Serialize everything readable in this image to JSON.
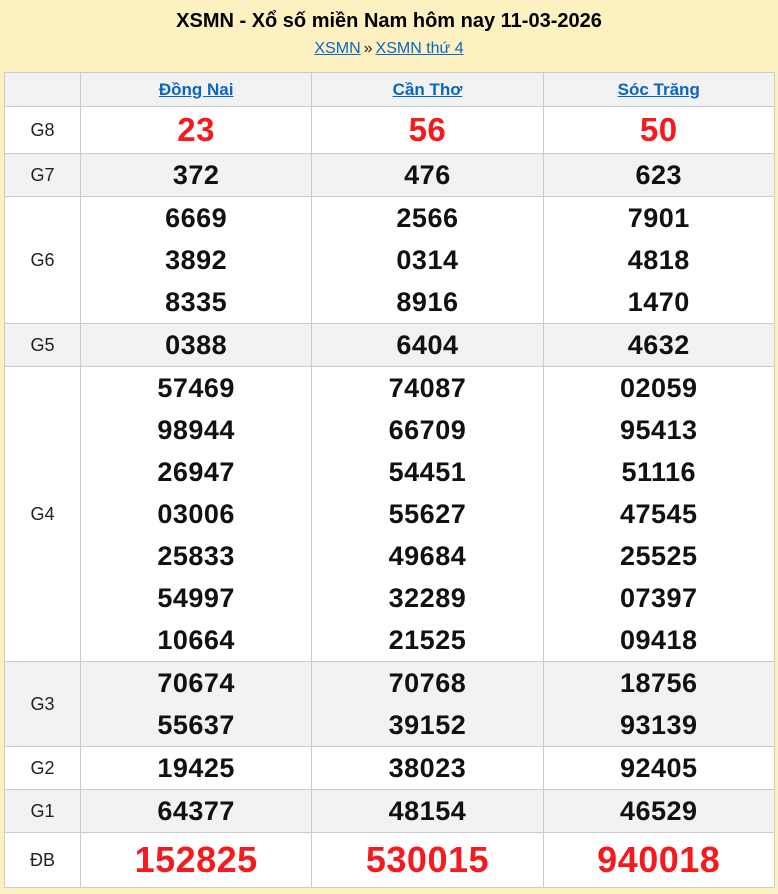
{
  "page": {
    "title": "XSMN - Xổ số miền Nam hôm nay 11-03-2026",
    "breadcrumb": {
      "home": "XSMN",
      "separator": "»",
      "current": "XSMN thứ 4"
    }
  },
  "colors": {
    "background": "#fdf1c1",
    "link_blue": "#0866c6",
    "highlight_red": "#f41a1e",
    "row_alt_gray": "#f2f2f2",
    "border_gray": "#cccccc"
  },
  "table": {
    "columns": [
      "Đồng Nai",
      "Cần Thơ",
      "Sóc Trăng"
    ],
    "groups": [
      {
        "label": "G8",
        "highlight": true,
        "size": "large",
        "cells": [
          [
            "23"
          ],
          [
            "56"
          ],
          [
            "50"
          ]
        ]
      },
      {
        "label": "G7",
        "cells": [
          [
            "372"
          ],
          [
            "476"
          ],
          [
            "623"
          ]
        ]
      },
      {
        "label": "G6",
        "cells": [
          [
            "6669",
            "3892",
            "8335"
          ],
          [
            "2566",
            "0314",
            "8916"
          ],
          [
            "7901",
            "4818",
            "1470"
          ]
        ]
      },
      {
        "label": "G5",
        "cells": [
          [
            "0388"
          ],
          [
            "6404"
          ],
          [
            "4632"
          ]
        ]
      },
      {
        "label": "G4",
        "cells": [
          [
            "57469",
            "98944",
            "26947",
            "03006",
            "25833",
            "54997",
            "10664"
          ],
          [
            "74087",
            "66709",
            "54451",
            "55627",
            "49684",
            "32289",
            "21525"
          ],
          [
            "02059",
            "95413",
            "51116",
            "47545",
            "25525",
            "07397",
            "09418"
          ]
        ]
      },
      {
        "label": "G3",
        "cells": [
          [
            "70674",
            "55637"
          ],
          [
            "70768",
            "39152"
          ],
          [
            "18756",
            "93139"
          ]
        ]
      },
      {
        "label": "G2",
        "cells": [
          [
            "19425"
          ],
          [
            "38023"
          ],
          [
            "92405"
          ]
        ]
      },
      {
        "label": "G1",
        "cells": [
          [
            "64377"
          ],
          [
            "48154"
          ],
          [
            "46529"
          ]
        ]
      },
      {
        "label": "ĐB",
        "highlight": true,
        "size": "xlarge",
        "cells": [
          [
            "152825"
          ],
          [
            "530015"
          ],
          [
            "940018"
          ]
        ]
      }
    ]
  }
}
